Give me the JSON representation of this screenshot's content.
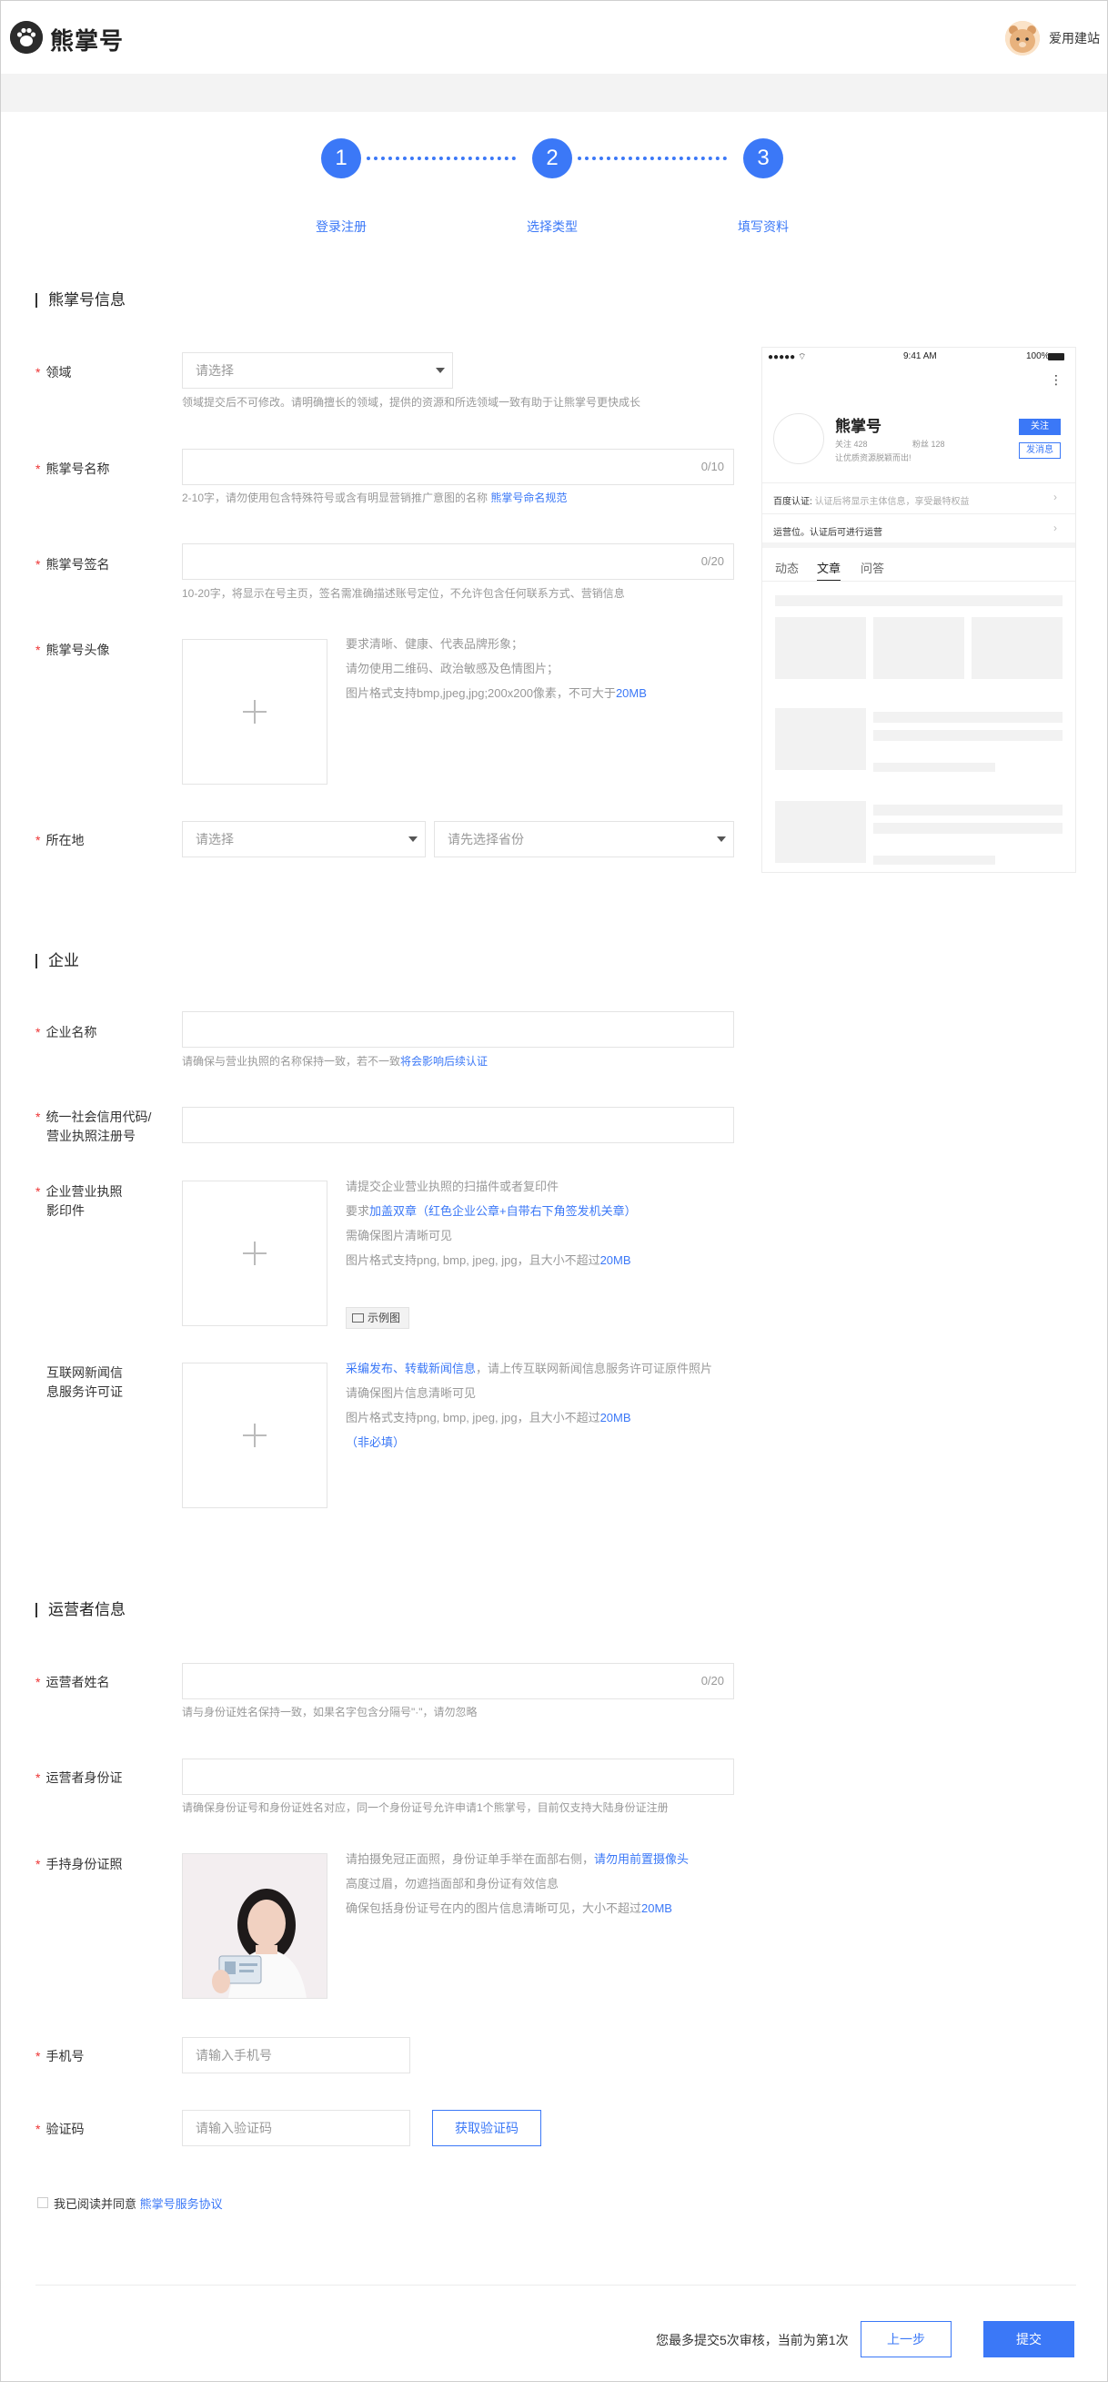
{
  "header": {
    "logo_text": "熊掌号",
    "username": "爱用建站"
  },
  "steps": [
    {
      "num": "1",
      "label": "登录注册"
    },
    {
      "num": "2",
      "label": "选择类型"
    },
    {
      "num": "3",
      "label": "填写资料"
    }
  ],
  "section1": {
    "title": "熊掌号信息",
    "field": {
      "label": "领域",
      "placeholder": "请选择",
      "hint": "领域提交后不可修改。请明确擅长的领域，提供的资源和所选领域一致有助于让熊掌号更快成长"
    },
    "name": {
      "label": "熊掌号名称",
      "counter": "0/10",
      "hint_a": "2-10字，请勿使用包含特殊符号或含有明显营销推广意图的名称",
      "hint_link": "熊掌号命名规范"
    },
    "sign": {
      "label": "熊掌号签名",
      "counter": "0/20",
      "hint": "10-20字，将显示在号主页，签名需准确描述账号定位，不允许包含任何联系方式、营销信息"
    },
    "avatar": {
      "label": "熊掌号头像",
      "hint1": "要求清晰、健康、代表品牌形象；",
      "hint2": "请勿使用二维码、政治敏感及色情图片；",
      "hint3_a": "图片格式支持bmp,jpeg,jpg;200x200像素，不可大于",
      "hint3_link": "20MB"
    },
    "location": {
      "label": "所在地",
      "province_placeholder": "请选择",
      "city_placeholder": "请先选择省份"
    }
  },
  "preview": {
    "status_time": "9:41 AM",
    "battery": "100%",
    "account_name": "熊掌号",
    "follow_count": "关注 428",
    "fans_count": "粉丝 128",
    "tagline": "让优质资源脱颖而出!",
    "follow_btn": "关注",
    "msg_btn": "发消息",
    "baidu_verify": "百度认证:",
    "baidu_verify_desc": "认证后将显示主体信息，享受最特权益",
    "ops_label": "运营位。认证后可进行运营",
    "tabs": [
      "动态",
      "文章",
      "问答"
    ],
    "more_icon": "more-dots-icon"
  },
  "section2": {
    "title": "企业",
    "company_name": {
      "label": "企业名称",
      "hint_a": "请确保与营业执照的名称保持一致，若不一致",
      "hint_link": "将会影响后续认证"
    },
    "credit_code": {
      "label_line1": "统一社会信用代码/",
      "label_line2": "营业执照注册号"
    },
    "license": {
      "label_line1": "企业营业执照",
      "label_line2": "影印件",
      "hint1": "请提交企业营业执照的扫描件或者复印件",
      "hint2_a": "要求",
      "hint2_link": "加盖双章（红色企业公章+自带右下角签发机关章）",
      "hint3": "需确保图片清晰可见",
      "hint4_a": "图片格式支持png, bmp, jpeg, jpg，且大小不超过",
      "hint4_link": "20MB",
      "example_btn": "示例图"
    },
    "news_permit": {
      "label_line1": "互联网新闻信",
      "label_line2": "息服务许可证",
      "hint1_link": "采编发布、转载新闻信息",
      "hint1_b": "，请上传互联网新闻信息服务许可证原件照片",
      "hint2": "请确保图片信息清晰可见",
      "hint3_a": "图片格式支持png, bmp, jpeg, jpg，且大小不超过",
      "hint3_link": "20MB",
      "hint4": "（非必填）"
    }
  },
  "section3": {
    "title": "运营者信息",
    "op_name": {
      "label": "运营者姓名",
      "counter": "0/20",
      "hint": "请与身份证姓名保持一致，如果名字包含分隔号\"·\"，请勿忽略"
    },
    "op_id": {
      "label": "运营者身份证",
      "hint": "请确保身份证号和身份证姓名对应，同一个身份证号允许申请1个熊掌号，目前仅支持大陆身份证注册"
    },
    "hold_id": {
      "label": "手持身份证照",
      "hint1_a": "请拍摄免冠正面照，身份证单手举在面部右侧，",
      "hint1_link": "请勿用前置摄像头",
      "hint2": "高度过眉，勿遮挡面部和身份证有效信息",
      "hint3_a": "确保包括身份证号在内的图片信息清晰可见，大小不超过",
      "hint3_link": "20MB"
    },
    "phone": {
      "label": "手机号",
      "placeholder": "请输入手机号"
    },
    "code": {
      "label": "验证码",
      "placeholder": "请输入验证码",
      "button": "获取验证码"
    },
    "agreement_a": "我已阅读并同意",
    "agreement_link": "熊掌号服务协议"
  },
  "footer": {
    "submit_note": "您最多提交5次审核，当前为第1次",
    "prev_btn": "上一步",
    "submit_btn": "提交"
  }
}
